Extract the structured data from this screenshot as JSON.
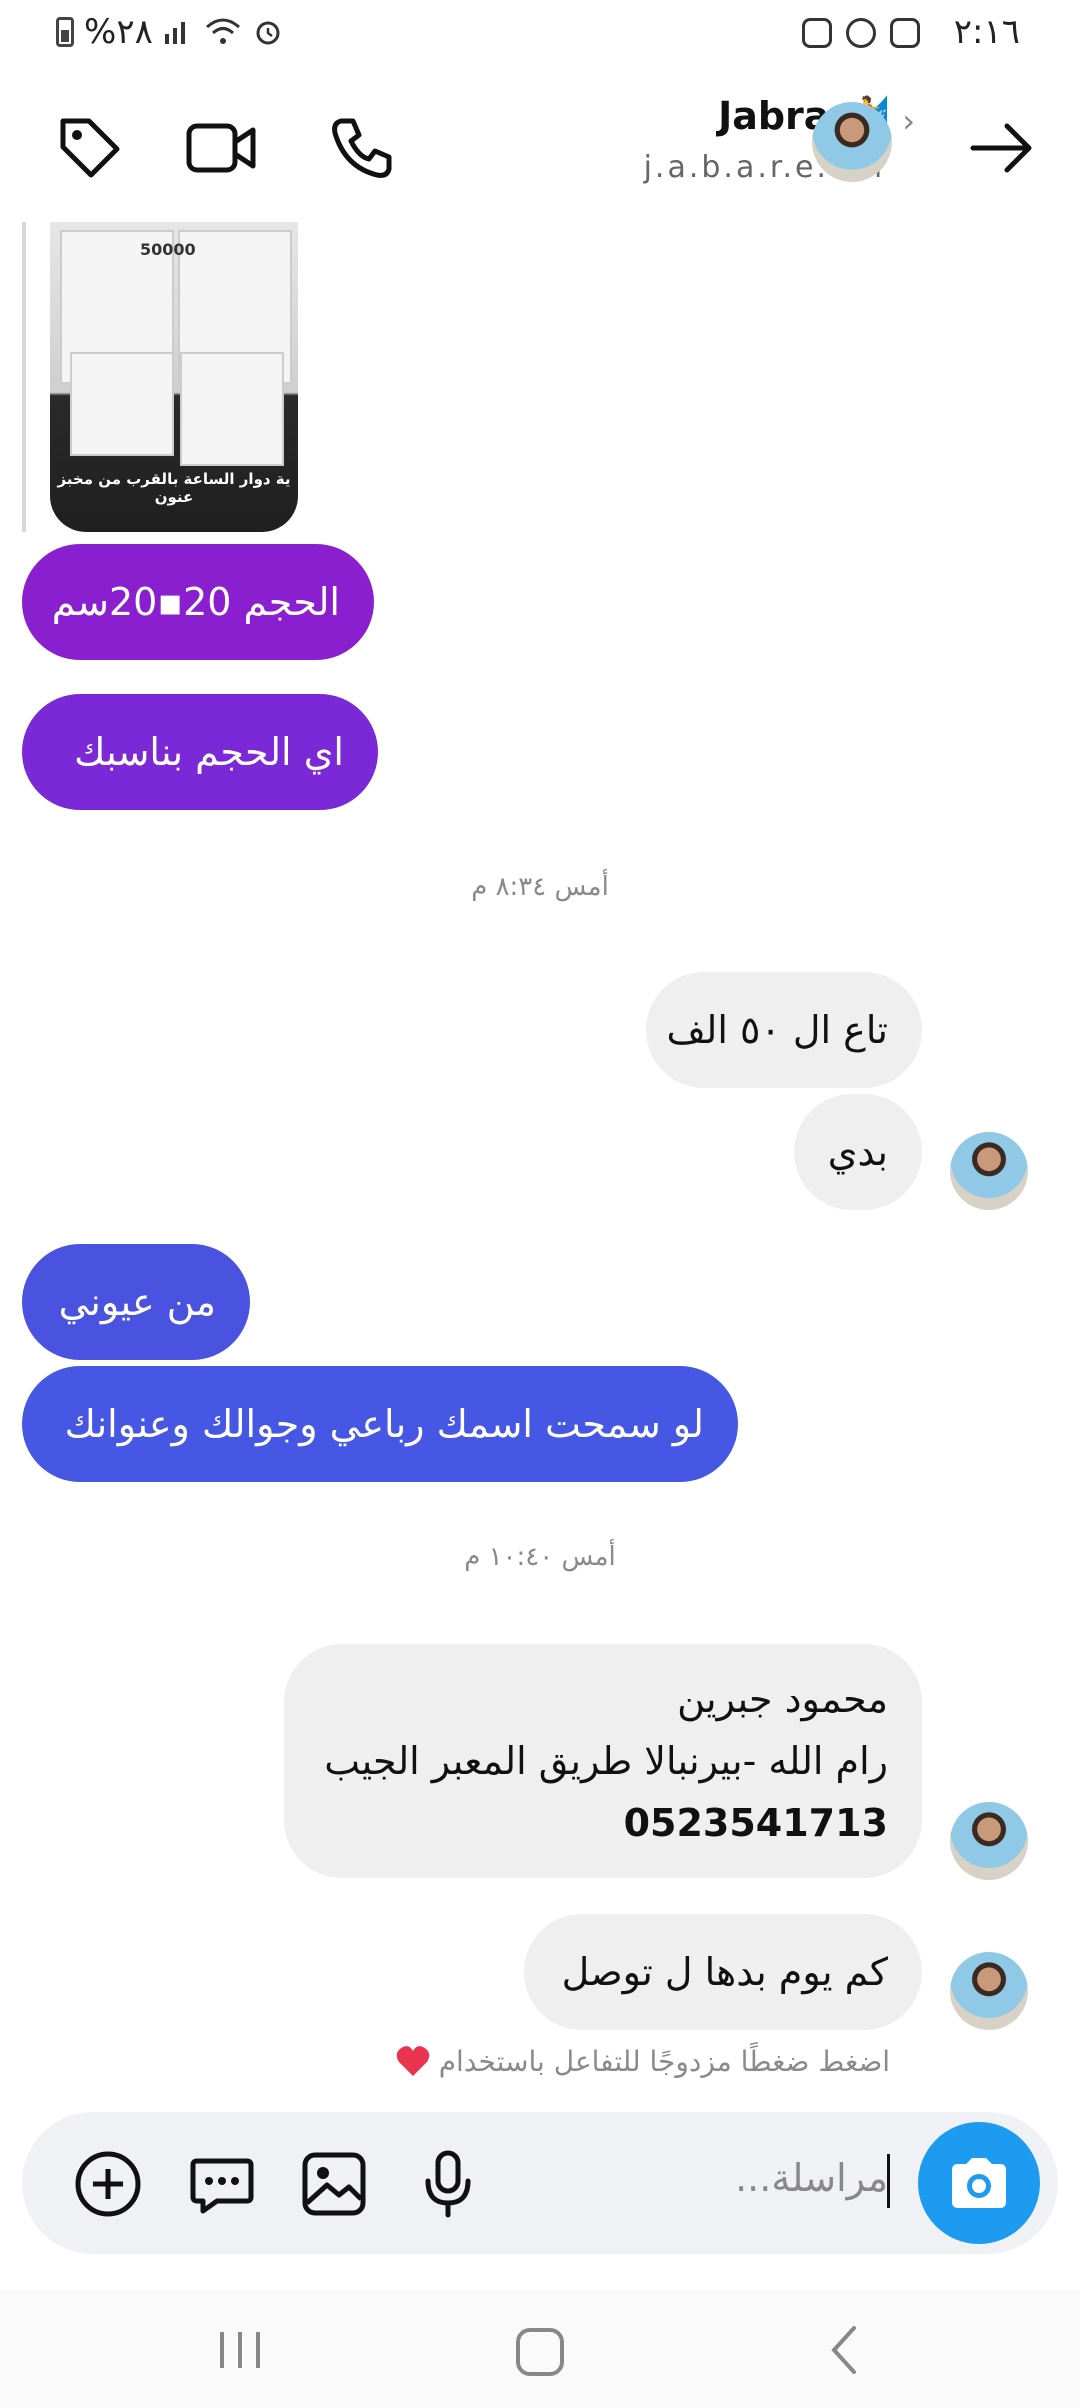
{
  "status_bar": {
    "time": "٢:١٦",
    "battery_text": "%٢٨",
    "icons_right": [
      "instagram-icon",
      "whatsapp-icon",
      "instagram-icon"
    ],
    "icons_left": [
      "battery-icon",
      "signal-icon",
      "wifi-icon",
      "alarm-icon"
    ]
  },
  "header": {
    "contact_name": "Jabra 🏄",
    "contact_handle": "j.a.b.a.r.e.e.n",
    "icons": [
      "tag-icon",
      "video-call-icon",
      "phone-icon",
      "back-arrow-icon"
    ]
  },
  "messages": {
    "image_caption": "ية دوار الساعة بالقرب من مخبز عنون",
    "image_number": "50000",
    "m1": "الحجم 20▪20سم",
    "m2": "اي الحجم  بناسبك",
    "ts1": "أمس ٨:٣٤ م",
    "m3": "تاع ال ٥٠ الف",
    "m4": "بدي",
    "m5": "من عيوني",
    "m6": "لو سمحت اسمك رباعي وجوالك وعنوانك",
    "ts2": "أمس ١٠:٤٠ م",
    "m7_line1": "محمود جبرين",
    "m7_line2": "رام الله -بيرنبالا طريق المعبر الجيب",
    "m7_line3": "0523541713",
    "m8": "كم يوم بدها ل توصل",
    "hint": "اضغط ضغطًا مزدوجًا للتفاعل باستخدام"
  },
  "composer": {
    "placeholder": "مراسلة...",
    "icons": [
      "add-icon",
      "sticker-chat-icon",
      "gallery-icon",
      "microphone-icon",
      "camera-icon"
    ]
  },
  "colors": {
    "bubble_purple": "#8a1fd0",
    "bubble_violet": "#7b28d6",
    "bubble_indigo": "#4a52e0",
    "bubble_blue": "#4557e3",
    "bubble_gray": "#efefef",
    "camera_blue": "#1c9bf0"
  }
}
